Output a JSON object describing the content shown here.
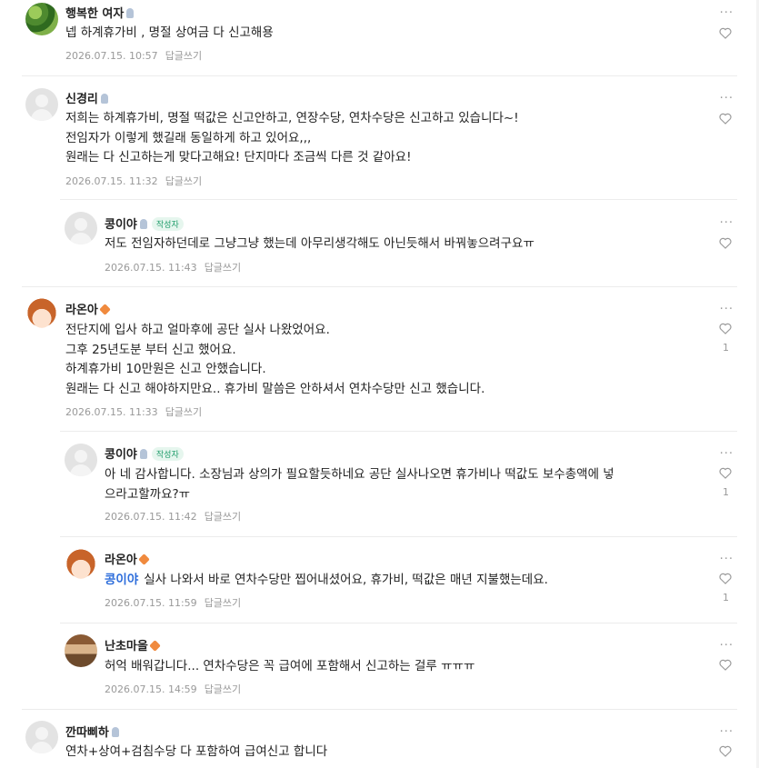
{
  "comments": [
    {
      "name": "행복한 여자",
      "text": [
        "넵 하계휴가비 , 명절 상여금 다 신고해용"
      ],
      "date": "2026.07.15. 10:57",
      "reply": "답글쓰기",
      "more": "···",
      "likes": ""
    },
    {
      "name": "신경리",
      "text": [
        "저희는 하계휴가비, 명절 떡값은 신고안하고, 연장수당, 연차수당은 신고하고 있습니다~!",
        "전임자가 이렇게 했길래 동일하게 하고 있어요,,,",
        "원래는 다 신고하는게 맞다고해요! 단지마다 조금씩 다른 것 같아요!"
      ],
      "date": "2026.07.15. 11:32",
      "reply": "답글쓰기",
      "more": "···",
      "likes": ""
    },
    {
      "name": "콩이야",
      "badge": "작성자",
      "text": [
        "저도 전임자하던데로 그냥그냥 했는데 아무리생각해도 아닌듯해서 바꿔놓으려구요ㅠ"
      ],
      "date": "2026.07.15. 11:43",
      "reply": "답글쓰기",
      "more": "···",
      "likes": ""
    },
    {
      "name": "라온아",
      "text": [
        "전단지에 입사 하고 얼마후에 공단 실사 나왔었어요.",
        "그후 25년도분 부터 신고 했어요.",
        "하계휴가비 10만원은 신고 안했습니다.",
        "원래는 다 신고 해야하지만요.. 휴가비 말씀은 안하셔서 연차수당만 신고 했습니다."
      ],
      "date": "2026.07.15. 11:33",
      "reply": "답글쓰기",
      "more": "···",
      "likes": "1"
    },
    {
      "name": "콩이야",
      "badge": "작성자",
      "text": [
        "아 네 감사합니다. 소장님과 상의가 필요할듯하네요 공단 실사나오면 휴가비나 떡값도 보수총액에 넣",
        "으라고할까요?ㅠ"
      ],
      "date": "2026.07.15. 11:42",
      "reply": "답글쓰기",
      "more": "···",
      "likes": "1"
    },
    {
      "name": "라온아",
      "mention": "콩이야",
      "text": [
        "실사 나와서 바로 연차수당만 찝어내셨어요, 휴가비, 떡값은 매년 지불했는데요."
      ],
      "date": "2026.07.15. 11:59",
      "reply": "답글쓰기",
      "more": "···",
      "likes": "1"
    },
    {
      "name": "난초마을",
      "text": [
        "허억 배워갑니다... 연차수당은 꼭 급여에 포함해서 신고하는 걸루 ㅠㅠㅠ"
      ],
      "date": "2026.07.15. 14:59",
      "reply": "답글쓰기",
      "more": "···",
      "likes": ""
    },
    {
      "name": "깐따삐하",
      "text": [
        "연차+상여+검침수당 다 포함하여 급여신고 합니다"
      ],
      "date": "",
      "reply": "",
      "more": "···",
      "likes": ""
    }
  ],
  "icons": {
    "heart": "heart-icon",
    "more": "more-icon",
    "grade": "grade-icon"
  }
}
